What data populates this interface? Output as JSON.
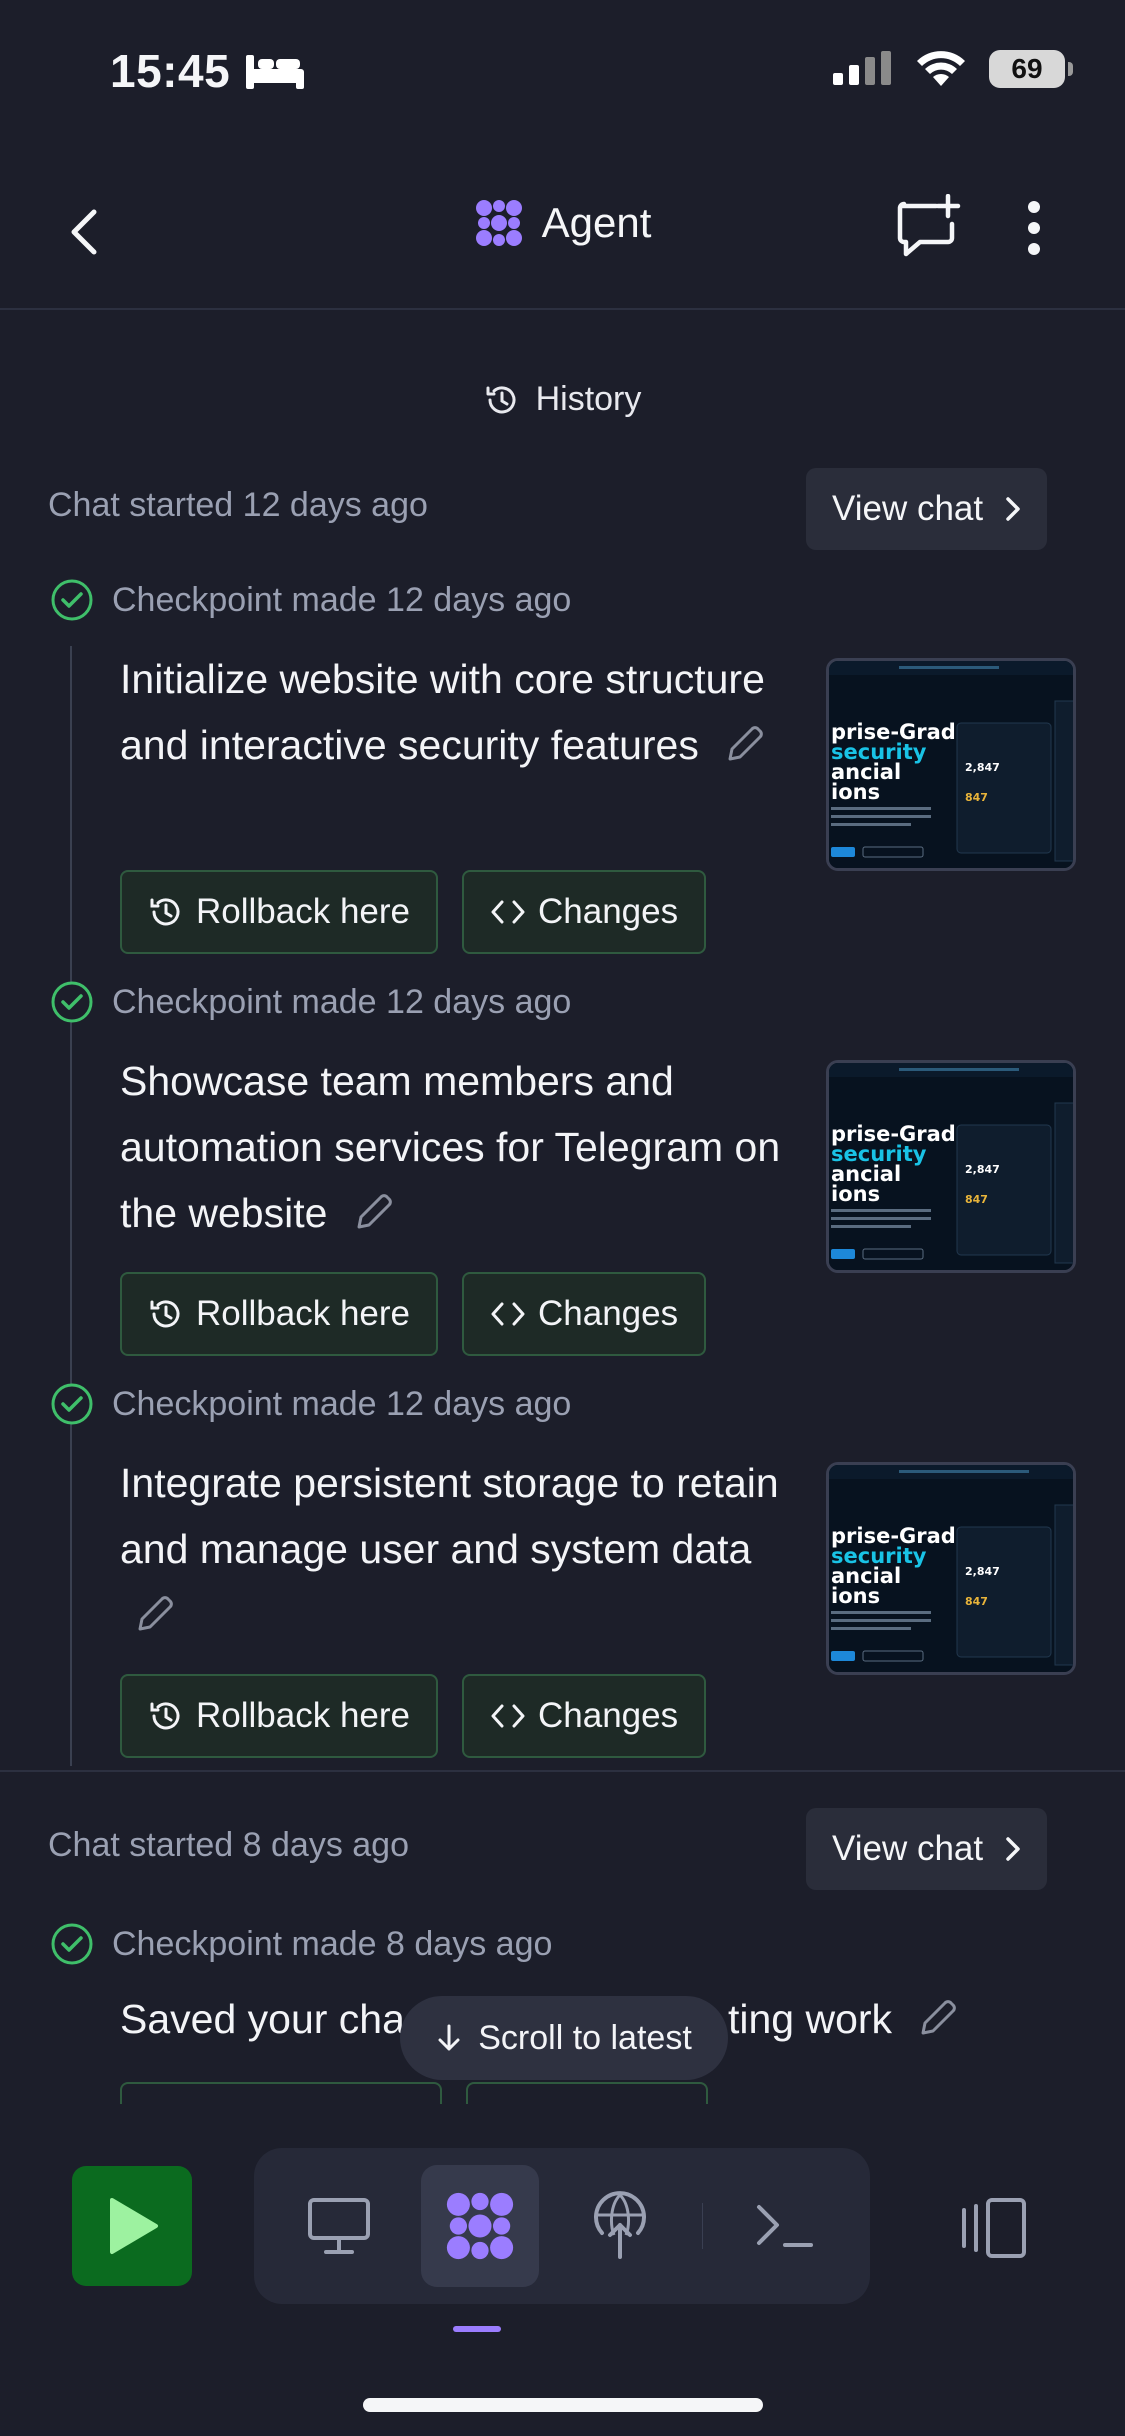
{
  "status_bar": {
    "time": "15:45",
    "battery": "69"
  },
  "header": {
    "title": "Agent"
  },
  "history_label": "History",
  "sessions": [
    {
      "started": "Chat started 12 days ago",
      "view_chat": "View chat",
      "checkpoints": [
        {
          "made": "Checkpoint made 12 days ago",
          "title": "Initialize website with core structure and interactive security features",
          "rollback": "Rollback here",
          "changes": "Changes"
        },
        {
          "made": "Checkpoint made 12 days ago",
          "title": "Showcase team members and automation services for Telegram on the website",
          "rollback": "Rollback here",
          "changes": "Changes"
        },
        {
          "made": "Checkpoint made 12 days ago",
          "title": "Integrate persistent storage to retain and manage user and system data",
          "rollback": "Rollback here",
          "changes": "Changes"
        }
      ]
    },
    {
      "started": "Chat started 8 days ago",
      "view_chat": "View chat",
      "checkpoints": [
        {
          "made": "Checkpoint made 8 days ago",
          "title": "Saved your cha",
          "title_tail": "ting work"
        }
      ]
    }
  ],
  "thumbnail": {
    "l1": "prise-Grade",
    "l2": "security",
    "l3": "ancial",
    "l4": "ions",
    "stat1": "2,847",
    "stat2": "847"
  },
  "scroll_to_latest": "Scroll to latest",
  "colors": {
    "accent": "#9b7dff",
    "run": "#0b6b1f",
    "check": "#3fbf6a",
    "bg": "#1c1e2a"
  }
}
